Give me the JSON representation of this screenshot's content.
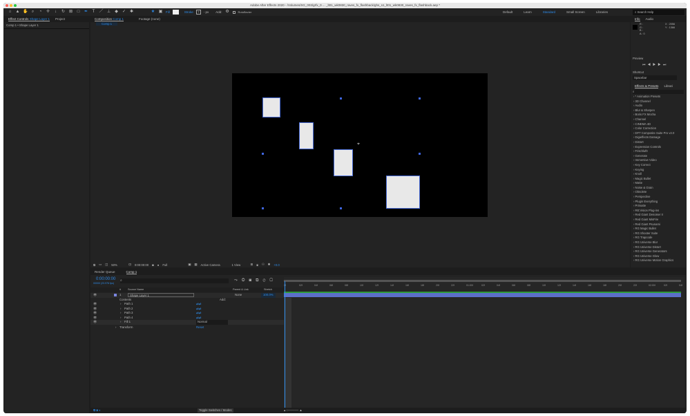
{
  "window": {
    "title": "Adobe After Effects 2020 - /Volumes/SG_003/grfx_0 ... _lt01_wk0830_raves_fx_flashback/ghs_s1_lt01_wk0830_raves_fx_flashback.aep *"
  },
  "toolbar": {
    "fill_label": "Fill",
    "stroke_label": "Stroke",
    "stroke_value": "?",
    "stroke_px": "- px",
    "add_label": "Add:",
    "rotobezier_label": "RotoBezier"
  },
  "workspaces": {
    "items": [
      "Default",
      "Learn",
      "Standard",
      "Small Screen",
      "Libraries"
    ],
    "active": "Standard",
    "search_placeholder": "Search Help"
  },
  "left_panel": {
    "tabs": [
      "Effect Controls",
      "Project"
    ],
    "effect_layer": "Shape Layer 1",
    "subtitle": "Comp 1 • Shape Layer 1"
  },
  "comp_panel": {
    "tab_label": "Composition",
    "comp_name": "Comp 1",
    "footage_tab": "Footage (none)",
    "breadcrumb": "Comp 1",
    "viewer": {
      "zoom": "50%",
      "timecode": "0:00:00:00",
      "resolution": "Full",
      "camera": "Active Camera",
      "views": "1 View",
      "exposure": "+0.0"
    }
  },
  "info": {
    "tabs": [
      "Info",
      "Audio"
    ],
    "r": "R :",
    "g": "G :",
    "b": "B :",
    "a": "A : 0",
    "x": "X : 2056",
    "y": "Y : 1366"
  },
  "preview": {
    "title": "Preview",
    "shortcut_label": "Shortcut",
    "shortcut_value": "Spacebar"
  },
  "effects": {
    "tabs": [
      "Effects & Presets",
      "Librari"
    ],
    "search_placeholder": "",
    "items": [
      "* Animation Presets",
      "3D Channel",
      "Audio",
      "Blur & Sharpen",
      "Boris FX Mocha",
      "Channel",
      "CINEMA 4D",
      "Color Correction",
      "DFT Composite Suite Pro v2.0",
      "Digieffects Damage",
      "Distort",
      "Expression Controls",
      "FrischluftI",
      "Generate",
      "Immersive Video",
      "Key Correct",
      "Keying",
      "Knoll",
      "Magic Bullet",
      "Matte",
      "Noise & Grain",
      "Obsolete",
      "Perspective",
      "Plugin Everything",
      "Primatte",
      "RE:Vision Plug-ins",
      "Red Giant Denoiser II",
      "Red Giant MisFire",
      "Red Giant Psunami",
      "RG Magic Bullet",
      "RG Shooter Suite",
      "RG Trapcode",
      "RG Universe Blur",
      "RG Universe Distort",
      "RG Universe Generators",
      "RG Universe Glow",
      "RG Universe Motion Graphics"
    ]
  },
  "timeline": {
    "tabs": [
      "Render Queue",
      "Comp 1"
    ],
    "timecode": "0:00:00:00",
    "frame_info": "00000 (23.976 fps)",
    "headers": {
      "source": "Source Name",
      "parent": "Parent & Link",
      "stretch": "Stretch",
      "num": "#"
    },
    "layer": {
      "num": "1",
      "name": "Shape Layer 1",
      "parent": "None",
      "stretch": "100.0%"
    },
    "contents_label": "Contents",
    "add_label": "Add:",
    "children": [
      "Path 1",
      "Path 2",
      "Path 3",
      "Path 4",
      "Fill 1"
    ],
    "fill_mode": "Normal",
    "transform_label": "Transform",
    "reset_label": "Reset",
    "ruler": [
      "0f",
      "02f",
      "04f",
      "06f",
      "08f",
      "10f",
      "12f",
      "14f",
      "16f",
      "18f",
      "20f",
      "22f",
      "01:00f",
      "02f",
      "04f",
      "06f",
      "08f",
      "10f",
      "12f",
      "14f",
      "16f",
      "18f",
      "20f",
      "22f",
      "02:00f",
      "02f",
      "04f"
    ],
    "toggle_label": "Toggle Switches / Modes"
  },
  "colors": {
    "accent": "#2d8ceb",
    "layer_bar": "#5b6fc9",
    "track_green": "#2f9a3a",
    "handle": "#3f66e0"
  }
}
